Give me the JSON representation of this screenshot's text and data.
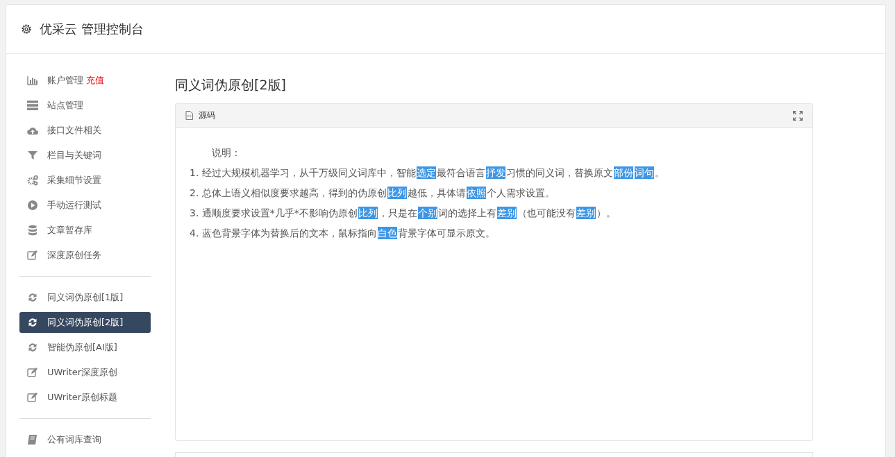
{
  "header": {
    "title": "优采云 管理控制台"
  },
  "sidebar": {
    "groups": [
      {
        "items": [
          {
            "label": "账户管理",
            "badge": "充值",
            "kind": "chart",
            "selected": false
          },
          {
            "label": "站点管理",
            "kind": "server",
            "selected": false
          },
          {
            "label": "接口文件相关",
            "kind": "cloud",
            "selected": false
          },
          {
            "label": "栏目与关键词",
            "kind": "filter",
            "selected": false
          },
          {
            "label": "采集细节设置",
            "kind": "gears",
            "selected": false
          },
          {
            "label": "手动运行测试",
            "kind": "play",
            "selected": false
          },
          {
            "label": "文章暂存库",
            "kind": "database",
            "selected": false
          },
          {
            "label": "深度原创任务",
            "kind": "edit",
            "selected": false
          }
        ]
      },
      {
        "items": [
          {
            "label": "同义词伪原创[1版]",
            "kind": "refresh",
            "selected": false
          },
          {
            "label": "同义词伪原创[2版]",
            "kind": "refresh",
            "selected": true
          },
          {
            "label": "智能伪原创[AI版]",
            "kind": "refresh",
            "selected": false
          },
          {
            "label": "UWriter深度原创",
            "kind": "edit",
            "selected": false
          },
          {
            "label": "UWriter原创标题",
            "kind": "edit",
            "selected": false
          }
        ]
      },
      {
        "items": [
          {
            "label": "公有词库查询",
            "kind": "book",
            "selected": false
          }
        ]
      }
    ]
  },
  "page": {
    "title": "同义词伪原创[2版]",
    "panel": {
      "title": "源码",
      "heading": "说明：",
      "lines": [
        [
          {
            "text": "1. 经过大规模机器学习，从千万级同义词库中，智能",
            "replaced": false
          },
          {
            "text": "选定",
            "replaced": true
          },
          {
            "text": "最符合语言",
            "replaced": false
          },
          {
            "text": "抒发",
            "replaced": true
          },
          {
            "text": "习惯的同义词，替换原文",
            "replaced": false
          },
          {
            "text": "部份",
            "replaced": true
          },
          {
            "text": "词句",
            "replaced": true
          },
          {
            "text": "。",
            "replaced": false
          }
        ],
        [
          {
            "text": "2. 总体上语义相似度要求越高，得到的伪原创",
            "replaced": false
          },
          {
            "text": "比列",
            "replaced": true
          },
          {
            "text": "越低，具体请",
            "replaced": false
          },
          {
            "text": "依照",
            "replaced": true
          },
          {
            "text": "个人需求设置。",
            "replaced": false
          }
        ],
        [
          {
            "text": "3. 通顺度要求设置*几乎*不影响伪原创",
            "replaced": false
          },
          {
            "text": "比列",
            "replaced": true
          },
          {
            "text": "，只是在",
            "replaced": false
          },
          {
            "text": "个别",
            "replaced": true
          },
          {
            "text": "词的选择上有",
            "replaced": false
          },
          {
            "text": "差别",
            "replaced": true
          },
          {
            "text": "（也可能没有",
            "replaced": false
          },
          {
            "text": "差别",
            "replaced": true
          },
          {
            "text": "）。",
            "replaced": false
          }
        ],
        [
          {
            "text": "4. 蓝色背景字体为替换后的文本，鼠标指向",
            "replaced": false
          },
          {
            "text": "白色",
            "replaced": true
          },
          {
            "text": "背景字体可显示原文。",
            "replaced": false
          }
        ]
      ]
    }
  }
}
